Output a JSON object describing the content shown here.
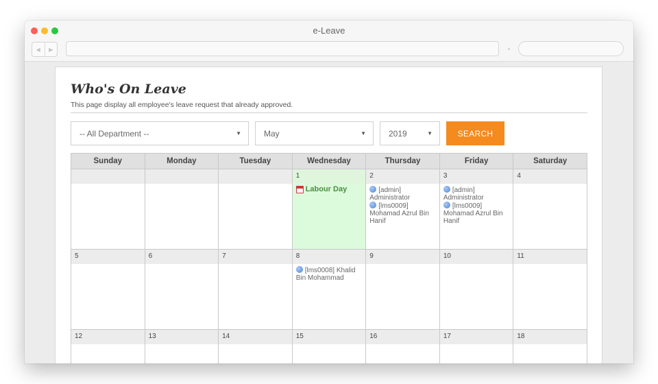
{
  "window": {
    "title": "e-Leave"
  },
  "page": {
    "title": "Who's On Leave",
    "subtitle": "This page display all employee's leave request that already approved."
  },
  "filters": {
    "department": "-- All Department --",
    "month": "May",
    "year": "2019",
    "search_label": "SEARCH"
  },
  "calendar": {
    "headers": [
      "Sunday",
      "Monday",
      "Tuesday",
      "Wednesday",
      "Thursday",
      "Friday",
      "Saturday"
    ],
    "weeks": [
      {
        "days": [
          "",
          "",
          "",
          "1",
          "2",
          "3",
          "4"
        ]
      },
      {
        "days": [
          "5",
          "6",
          "7",
          "8",
          "9",
          "10",
          "11"
        ]
      },
      {
        "days": [
          "12",
          "13",
          "14",
          "15",
          "16",
          "17",
          "18"
        ]
      }
    ],
    "holiday": {
      "label": "Labour Day",
      "icon": "calendar-icon"
    },
    "leaves": {
      "may2": [
        "[admin] Administrator",
        "[lms0009] Mohamad Azrul Bin Hanif"
      ],
      "may3": [
        "[admin] Administrator",
        "[lms0009] Mohamad Azrul Bin Hanif"
      ],
      "may8": [
        "[lms0008] Khalid Bin Mohammad"
      ]
    }
  },
  "colors": {
    "accent": "#f58a1f",
    "holiday_bg": "#dcfadc",
    "header_bg": "#e0e0e0"
  }
}
